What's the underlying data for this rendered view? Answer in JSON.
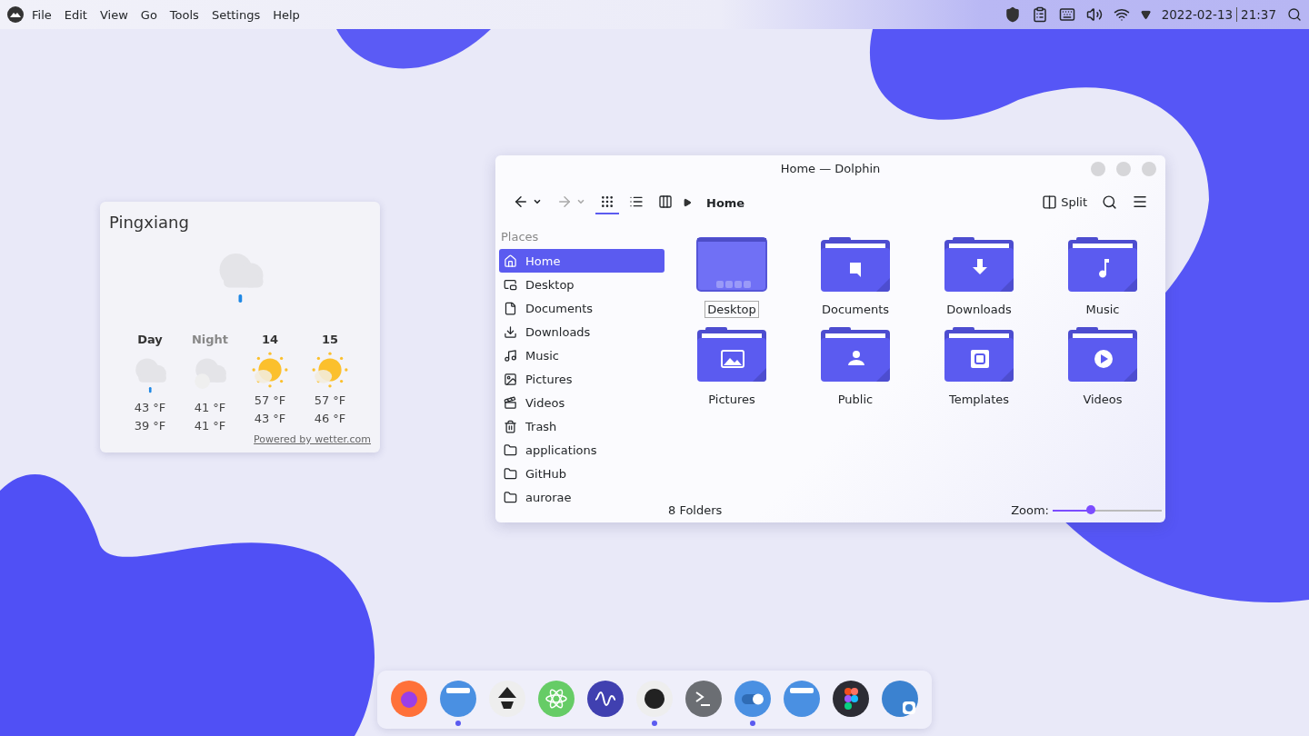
{
  "menubar": {
    "menus": [
      "File",
      "Edit",
      "View",
      "Go",
      "Tools",
      "Settings",
      "Help"
    ],
    "date": "2022-02-13",
    "time": "21:37"
  },
  "weather": {
    "city": "Pingxiang",
    "link": "Powered by wetter.com",
    "days": [
      {
        "label": "Day",
        "dimmed": false,
        "kind": "rain",
        "high": "43 °F",
        "low": "39 °F"
      },
      {
        "label": "Night",
        "dimmed": true,
        "kind": "cloudy",
        "high": "41 °F",
        "low": "41 °F"
      },
      {
        "label": "14",
        "dimmed": false,
        "kind": "sun",
        "high": "57 °F",
        "low": "43 °F"
      },
      {
        "label": "15",
        "dimmed": false,
        "kind": "sun",
        "high": "57 °F",
        "low": "46 °F"
      }
    ]
  },
  "dolphin": {
    "title": "Home — Dolphin",
    "breadcrumb": "Home",
    "split": "Split",
    "view_modes": [
      {
        "kind": "icons",
        "selected": true
      },
      {
        "kind": "details",
        "selected": false
      },
      {
        "kind": "columns",
        "selected": false
      }
    ],
    "places_header": "Places",
    "places": [
      {
        "label": "Home",
        "selected": true
      },
      {
        "label": "Desktop",
        "selected": false
      },
      {
        "label": "Documents",
        "selected": false
      },
      {
        "label": "Downloads",
        "selected": false
      },
      {
        "label": "Music",
        "selected": false
      },
      {
        "label": "Pictures",
        "selected": false
      },
      {
        "label": "Videos",
        "selected": false
      },
      {
        "label": "Trash",
        "selected": false
      },
      {
        "label": "applications",
        "selected": false
      },
      {
        "label": "GitHub",
        "selected": false
      },
      {
        "label": "aurorae",
        "selected": false
      }
    ],
    "folders": [
      {
        "name": "Desktop",
        "kind": "desktop",
        "selected": true
      },
      {
        "name": "Documents",
        "kind": "documents",
        "selected": false
      },
      {
        "name": "Downloads",
        "kind": "downloads",
        "selected": false
      },
      {
        "name": "Music",
        "kind": "music",
        "selected": false
      },
      {
        "name": "Pictures",
        "kind": "pictures",
        "selected": false
      },
      {
        "name": "Public",
        "kind": "public",
        "selected": false
      },
      {
        "name": "Templates",
        "kind": "templates",
        "selected": false
      },
      {
        "name": "Videos",
        "kind": "videos",
        "selected": false
      }
    ],
    "status": "8 Folders",
    "zoom_label": "Zoom:",
    "zoom": {
      "level": 0.35
    }
  },
  "dock": {
    "apps": [
      {
        "kind": "firefox",
        "running": false
      },
      {
        "kind": "files",
        "running": true
      },
      {
        "kind": "inkscape",
        "running": false
      },
      {
        "kind": "atom",
        "running": false
      },
      {
        "kind": "monitor",
        "running": false
      },
      {
        "kind": "github",
        "running": true
      },
      {
        "kind": "terminal",
        "running": false
      },
      {
        "kind": "toggle",
        "running": true
      },
      {
        "kind": "files",
        "running": false
      },
      {
        "kind": "figma",
        "running": false
      },
      {
        "kind": "store",
        "running": false
      }
    ]
  }
}
